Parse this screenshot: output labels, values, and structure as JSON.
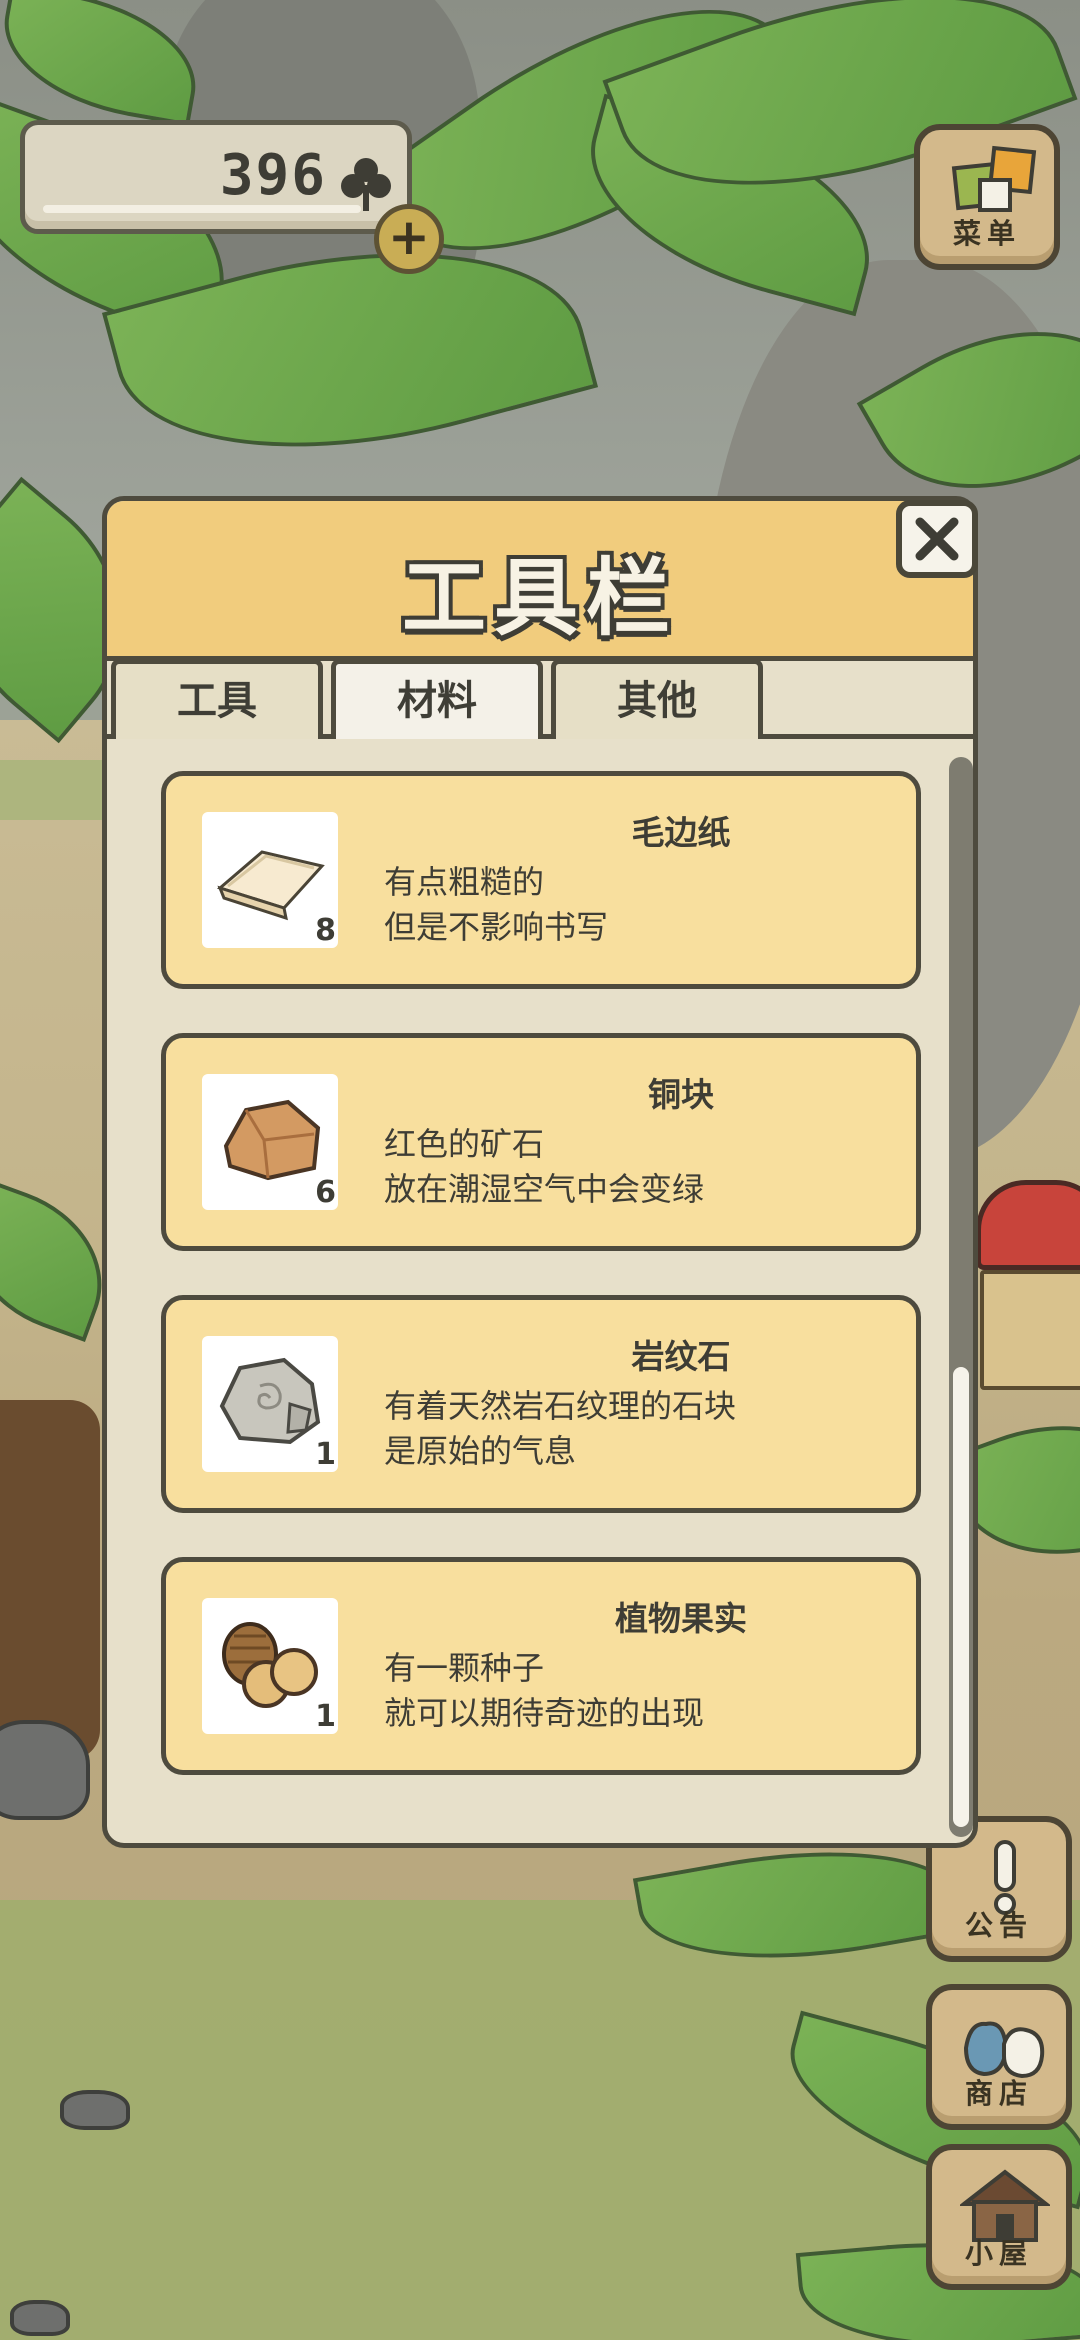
{
  "hud": {
    "clovers": "396",
    "add_label": "+"
  },
  "side_buttons": {
    "menu": "菜单",
    "notice": "公告",
    "shop": "商店",
    "house": "小屋"
  },
  "panel": {
    "title": "工具栏",
    "close_label": "✕",
    "tabs": [
      {
        "label": "工具",
        "active": false
      },
      {
        "label": "材料",
        "active": true
      },
      {
        "label": "其他",
        "active": false
      }
    ],
    "items": [
      {
        "name": "毛边纸",
        "count": "8",
        "desc1": "有点粗糙的",
        "desc2": "但是不影响书写",
        "icon": "paper-icon"
      },
      {
        "name": "铜块",
        "count": "6",
        "desc1": "红色的矿石",
        "desc2": "放在潮湿空气中会变绿",
        "icon": "copper-ore-icon"
      },
      {
        "name": "岩纹石",
        "count": "1",
        "desc1": "有着天然岩石纹理的石块",
        "desc2": "是原始的气息",
        "icon": "patterned-stone-icon"
      },
      {
        "name": "植物果实",
        "count": "1",
        "desc1": "有一颗种子",
        "desc2": "就可以期待奇迹的出现",
        "icon": "plant-fruit-icon"
      }
    ]
  },
  "colors": {
    "panel_header": "#f1cc7d",
    "item_card": "#f8df9e",
    "outline": "#4e4b3e"
  }
}
